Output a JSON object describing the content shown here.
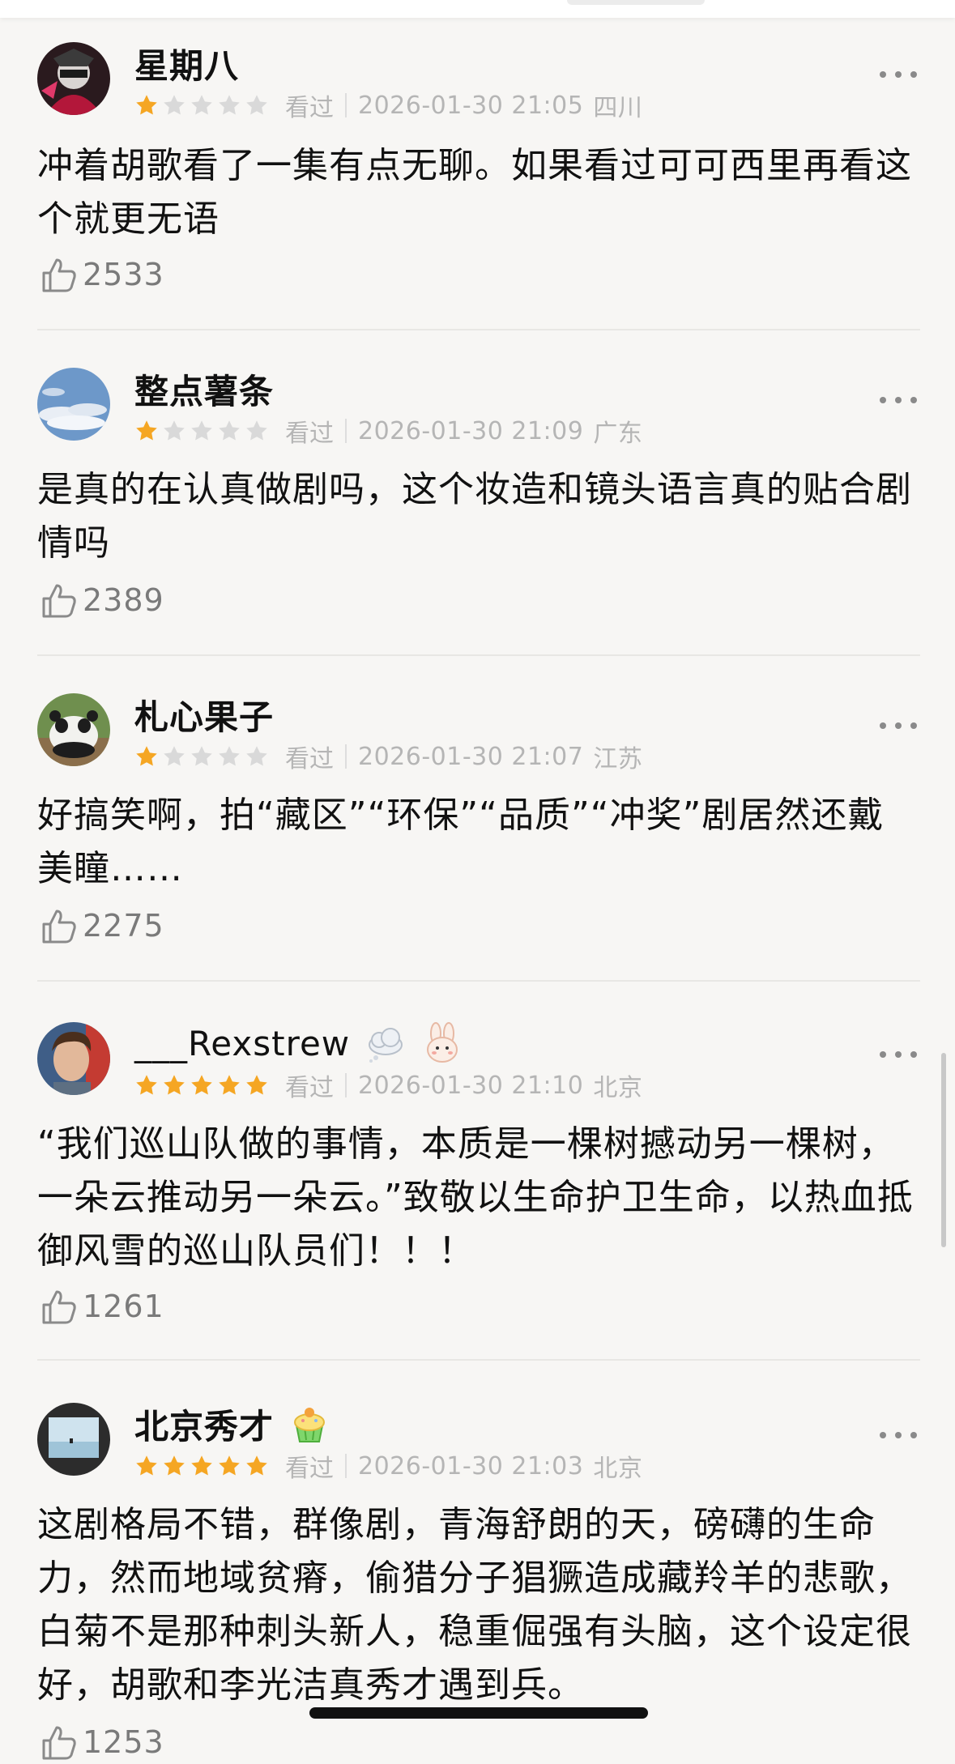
{
  "colors": {
    "background": "#f7f6f4",
    "star_active": "#f5a623",
    "star_inactive": "#d9d9d9",
    "meta_text": "#b5b5b5",
    "like_text": "#7a7a7a"
  },
  "comments": [
    {
      "user": "星期八",
      "rating": 1,
      "status": "看过",
      "datetime": "2026-01-30 21:05",
      "location": "四川",
      "text": "冲着胡歌看了一集有点无聊。如果看过可可西里再看这个就更无语",
      "likes": "2533",
      "avatar_icon": "masked-figure-avatar",
      "badges": []
    },
    {
      "user": "整点薯条",
      "rating": 1,
      "status": "看过",
      "datetime": "2026-01-30 21:09",
      "location": "广东",
      "text": "是真的在认真做剧吗，这个妆造和镜头语言真的贴合剧情吗",
      "likes": "2389",
      "avatar_icon": "sky-clouds-avatar",
      "badges": []
    },
    {
      "user": "札心果子",
      "rating": 1,
      "status": "看过",
      "datetime": "2026-01-30 21:07",
      "location": "江苏",
      "text": "好搞笑啊，拍“藏区”“环保”“品质”“冲奖”剧居然还戴美瞳……",
      "likes": "2275",
      "avatar_icon": "panda-avatar",
      "badges": []
    },
    {
      "user": "___Rexstrew",
      "rating": 5,
      "status": "看过",
      "datetime": "2026-01-30 21:10",
      "location": "北京",
      "text": "“我们巡山队做的事情，本质是一棵树撼动另一棵树，一朵云推动另一朵云。”致敬以生命护卫生命，以热血抵御风雪的巡山队员们！！！",
      "likes": "1261",
      "avatar_icon": "portrait-avatar",
      "badges": [
        "cloud-badge-icon",
        "bunny-badge-icon"
      ]
    },
    {
      "user": "北京秀才",
      "rating": 5,
      "status": "看过",
      "datetime": "2026-01-30 21:03",
      "location": "北京",
      "text": "这剧格局不错，群像剧，青海舒朗的天，磅礴的生命力，然而地域贫瘠，偷猎分子猖獗造成藏羚羊的悲歌，白菊不是那种刺头新人，稳重倔强有头脑，这个设定很好，胡歌和李光洁真秀才遇到兵。",
      "likes": "1253",
      "avatar_icon": "window-scene-avatar",
      "badges": [
        "cupcake-badge-icon"
      ]
    }
  ]
}
